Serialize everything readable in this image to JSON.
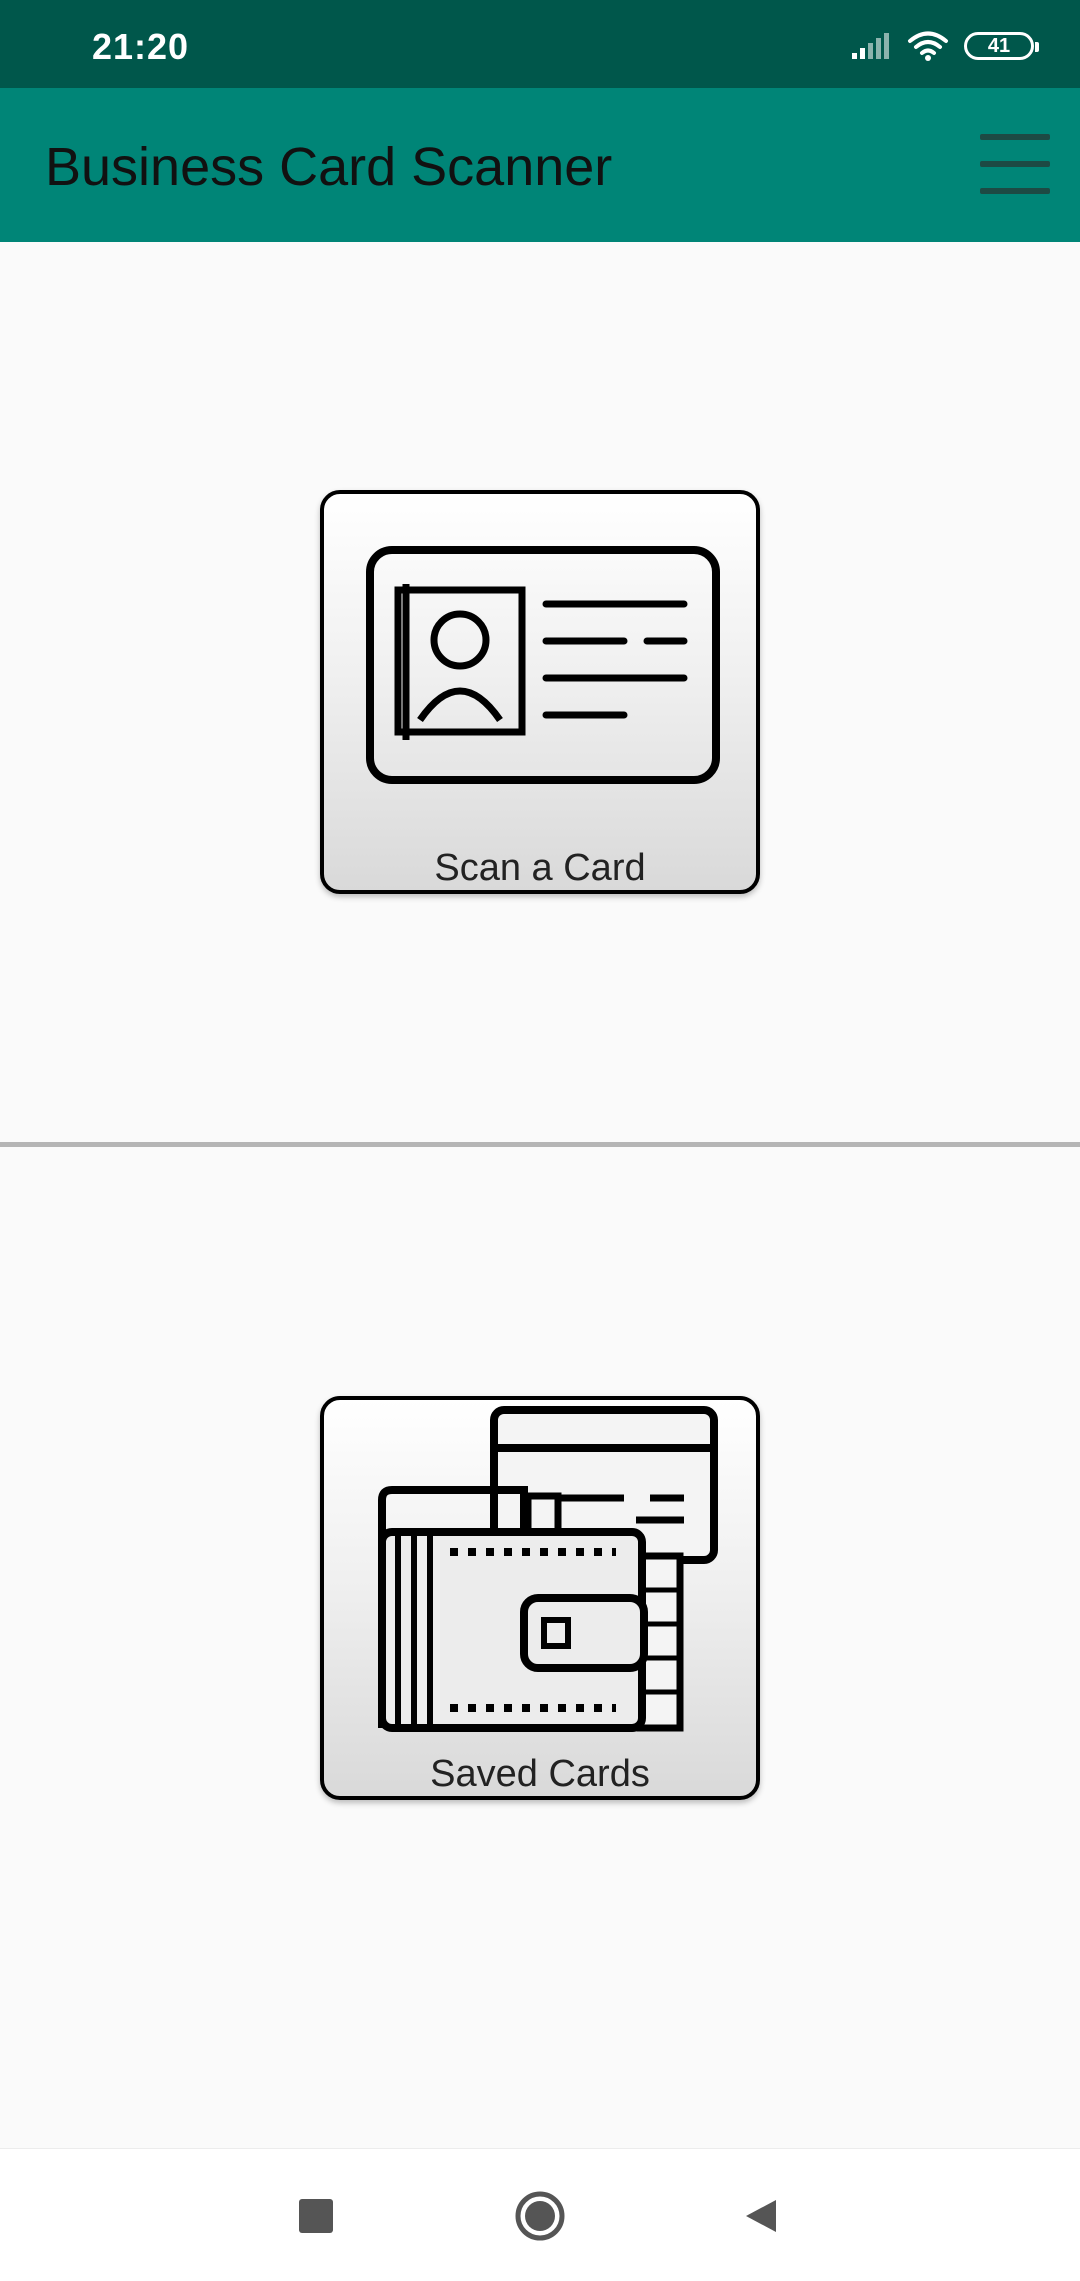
{
  "status_bar": {
    "time": "21:20",
    "battery": "41",
    "icons": [
      "signal-icon",
      "wifi-icon",
      "battery-icon"
    ]
  },
  "app_bar": {
    "title": "Business Card Scanner",
    "menu_icon": "hamburger-menu-icon"
  },
  "buttons": {
    "scan": {
      "label": "Scan a Card",
      "icon": "id-card-icon"
    },
    "saved": {
      "label": "Saved Cards",
      "icon": "wallet-cards-icon"
    }
  },
  "nav_bar": {
    "items": [
      "recent-apps-icon",
      "home-icon",
      "back-icon"
    ]
  },
  "colors": {
    "status_bar": "#00574b",
    "app_bar": "#008577",
    "background": "#fafafa",
    "divider": "#b5b5b5"
  }
}
